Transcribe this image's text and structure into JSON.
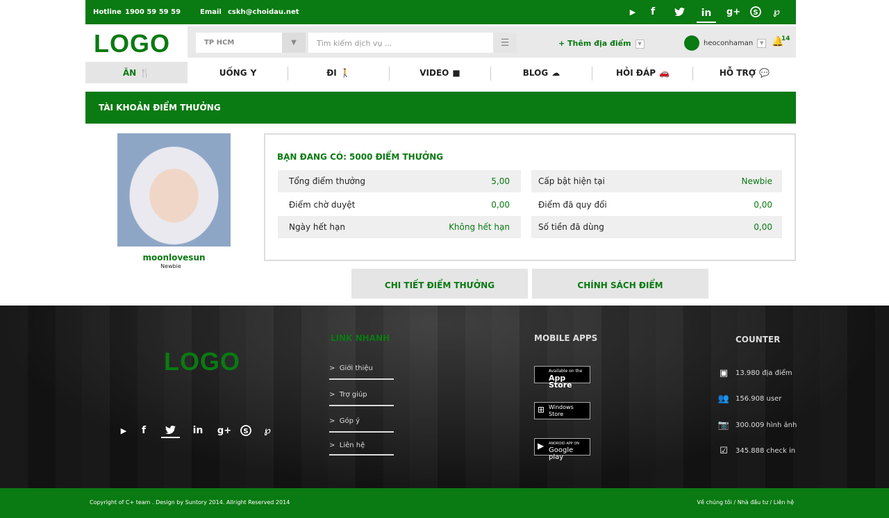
{
  "topbar": {
    "hotline_label": "Hotline",
    "hotline_value": "1900 59 59 59",
    "email_label": "Email",
    "email_value": "cskh@choidau.net",
    "social_icons": [
      "youtube-icon",
      "facebook-icon",
      "twitter-icon",
      "linkedin-icon",
      "googleplus-icon",
      "skype-icon",
      "pinterest-icon"
    ]
  },
  "header": {
    "logo": "LOGO",
    "city": "TP HCM",
    "search_placeholder": "Tìm kiếm dịch vụ ...",
    "add_place": "+ Thêm địa điểm",
    "username": "heoconhaman",
    "notification_count": "14"
  },
  "nav": {
    "items": [
      {
        "label": "ĂN"
      },
      {
        "label": "UỐNG"
      },
      {
        "label": "ĐI"
      },
      {
        "label": "VIDEO"
      },
      {
        "label": "BLOG"
      },
      {
        "label": "HỎI ĐÁP"
      },
      {
        "label": "HỖ TRỢ"
      }
    ]
  },
  "page": {
    "title": "TÀI KHOẢN ĐIỂM THƯỞNG"
  },
  "profile": {
    "username": "moonlovesun",
    "rank": "Newbie"
  },
  "points": {
    "heading": "BẠN ĐANG CÓ: 5000 ĐIỂM THƯỞNG",
    "left_rows": [
      {
        "label": "Tổng điểm thưởng",
        "value": "5,00"
      },
      {
        "label": "Điểm chờ duyệt",
        "value": "0,00"
      },
      {
        "label": "Ngày hết hạn",
        "value": "Không hết hạn"
      }
    ],
    "right_rows": [
      {
        "label": "Cấp bật hiện tại",
        "value": "Newbie"
      },
      {
        "label": "Điểm đã quy đổi",
        "value": "0,00"
      },
      {
        "label": "Số tiền đã dùng",
        "value": "0,00"
      }
    ]
  },
  "buttons": {
    "detail": "CHI TIẾT ĐIỂM THƯỞNG",
    "policy": "CHÍNH SÁCH ĐIỂM"
  },
  "footer": {
    "logo": "LOGO",
    "quick_links_title": "LINK NHANH",
    "quick_links": [
      "Giới thiệu",
      "Trợ giúp",
      "Góp ý",
      "Liên hệ"
    ],
    "mobile_title": "MOBILE APPS",
    "apps": [
      {
        "line1": "Available on the",
        "line2": "App Store",
        "icon": "apple-icon"
      },
      {
        "line1": "Windows",
        "line2": "Store",
        "icon": "windows-icon"
      },
      {
        "line1": "ANDROID APP ON",
        "line2": "Google play",
        "icon": "googleplay-icon"
      }
    ],
    "counter_title": "COUNTER",
    "counters": [
      {
        "text": "13.980 địa điểm",
        "icon": "calendar-icon"
      },
      {
        "text": "156.908 user",
        "icon": "users-icon"
      },
      {
        "text": "300.009 hình ảnh",
        "icon": "camera-icon"
      },
      {
        "text": "345.888 check in",
        "icon": "checkin-icon"
      }
    ],
    "copyright": "Copyright of C+ team . Design by Suntory 2014. Allright Reserved 2014",
    "bottom_links": "Về chúng tôi / Nhà đầu tư / Liên hệ"
  },
  "colors": {
    "brand_green": "#0a7a12"
  }
}
